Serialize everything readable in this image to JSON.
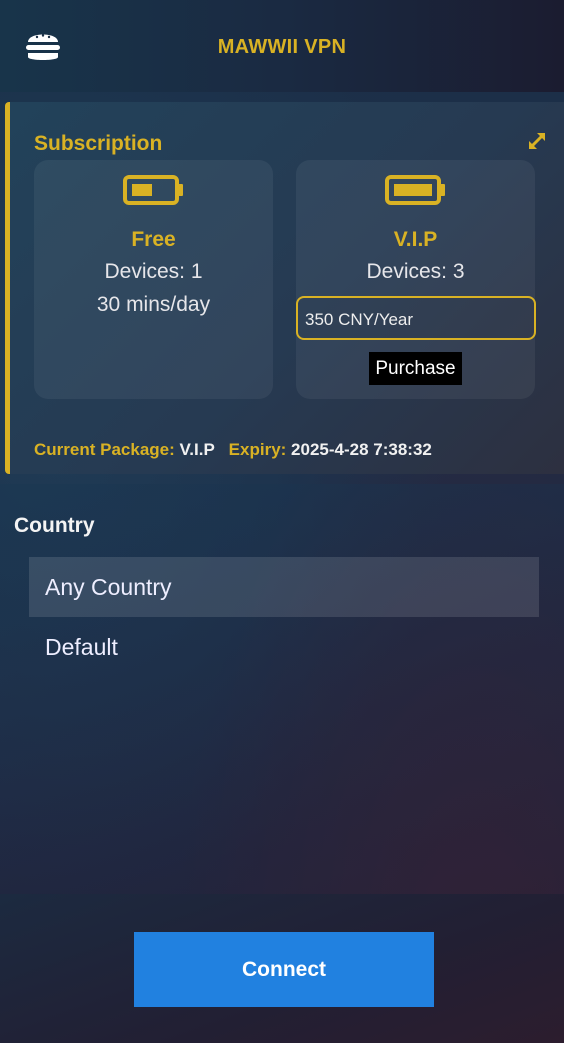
{
  "header": {
    "title": "MAWWII VPN",
    "menu_icon": "hamburger-icon"
  },
  "subscription": {
    "title": "Subscription",
    "expand_icon": "expand-icon",
    "plans": [
      {
        "name": "Free",
        "devices": "Devices: 1",
        "limit": "30 mins/day",
        "icon": "battery-half-icon"
      },
      {
        "name": "V.I.P",
        "devices": "Devices: 3",
        "price_option": "350 CNY/Year",
        "purchase_label": "Purchase",
        "icon": "battery-full-icon"
      }
    ],
    "current_package_label": "Current Package:",
    "current_package_value": "V.I.P",
    "expiry_label": "Expiry:",
    "expiry_value": "2025-4-28 7:38:32"
  },
  "country": {
    "heading": "Country",
    "items": [
      "Any Country",
      "Default"
    ],
    "selected": "Any Country"
  },
  "footer": {
    "connect_label": "Connect"
  },
  "colors": {
    "accent": "#d9b224",
    "button": "#2181e0"
  }
}
